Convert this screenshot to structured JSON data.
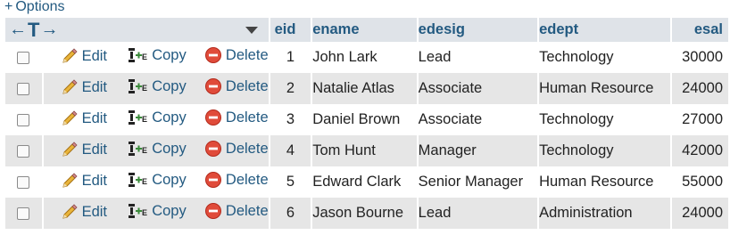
{
  "options": {
    "plus": "+",
    "label": "Options"
  },
  "nav": {
    "left": "←",
    "mid": "T",
    "right": "→"
  },
  "columns": [
    "eid",
    "ename",
    "edesig",
    "edept",
    "esal"
  ],
  "actions": {
    "edit": "Edit",
    "copy": "Copy",
    "delete": "Delete"
  },
  "rows": [
    {
      "eid": "1",
      "ename": "John Lark",
      "edesig": "Lead",
      "edept": "Technology",
      "esal": "30000"
    },
    {
      "eid": "2",
      "ename": "Natalie Atlas",
      "edesig": "Associate",
      "edept": "Human Resource",
      "esal": "24000"
    },
    {
      "eid": "3",
      "ename": "Daniel Brown",
      "edesig": "Associate",
      "edept": "Technology",
      "esal": "27000"
    },
    {
      "eid": "4",
      "ename": "Tom Hunt",
      "edesig": "Manager",
      "edept": "Technology",
      "esal": "42000"
    },
    {
      "eid": "5",
      "ename": "Edward Clark",
      "edesig": "Senior Manager",
      "edept": "Human Resource",
      "esal": "55000"
    },
    {
      "eid": "6",
      "ename": "Jason Bourne",
      "edesig": "Lead",
      "edept": "Administration",
      "esal": "24000"
    }
  ],
  "colors": {
    "link": "#235a81",
    "header_bg": "#dfe3e8",
    "row_alt": "#e6e6e6",
    "delete_icon": "#e04b3a",
    "edit_icon": "#e0a52a"
  },
  "icons": {
    "edit": "pencil-icon",
    "copy": "copy-insert-icon",
    "delete": "delete-circle-icon",
    "sort": "sort-down-triangle-icon"
  }
}
